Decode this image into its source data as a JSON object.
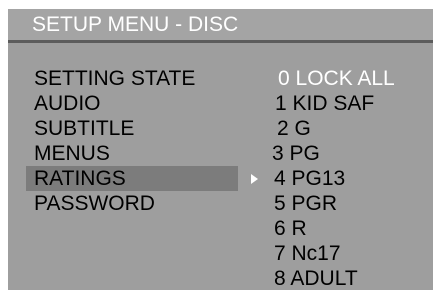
{
  "title": "SETUP MENU - DISC",
  "menu": {
    "items": [
      {
        "label": "SETTING STATE"
      },
      {
        "label": "AUDIO"
      },
      {
        "label": "SUBTITLE"
      },
      {
        "label": "MENUS"
      },
      {
        "label": "RATINGS",
        "selected": true
      },
      {
        "label": "PASSWORD"
      }
    ]
  },
  "ratings": {
    "options": [
      {
        "label": "0 LOCK ALL",
        "highlighted": true
      },
      {
        "label": "1 KID SAF"
      },
      {
        "label": "2 G"
      },
      {
        "label": "3 PG"
      },
      {
        "label": "4 PG13",
        "pointer": true
      },
      {
        "label": "5 PGR"
      },
      {
        "label": "6 R"
      },
      {
        "label": "7 Nc17"
      },
      {
        "label": "8 ADULT"
      }
    ]
  },
  "icons": {
    "pointer": "arrow-right-icon"
  },
  "colors": {
    "background": "#9e9e9e",
    "title_text": "#ffffff",
    "selected_bar": "#7c7c7c",
    "highlight_text": "#ffffff",
    "body_text": "#000000"
  }
}
